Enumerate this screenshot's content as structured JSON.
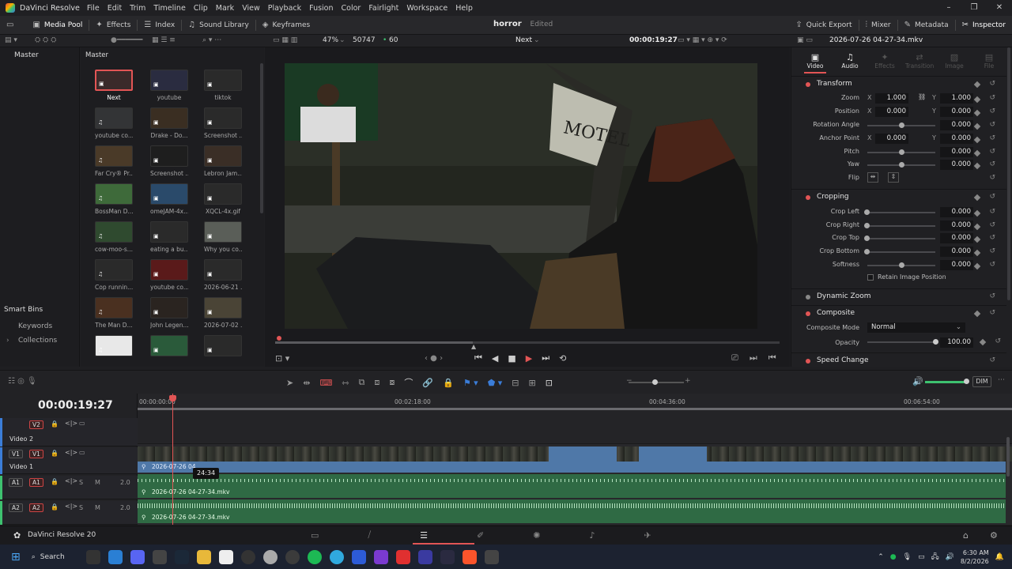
{
  "app": {
    "title": "DaVinci Resolve",
    "menu": [
      "File",
      "Edit",
      "Trim",
      "Timeline",
      "Clip",
      "Mark",
      "View",
      "Playback",
      "Fusion",
      "Color",
      "Fairlight",
      "Workspace",
      "Help"
    ]
  },
  "toolbar": {
    "media_pool": "Media Pool",
    "effects": "Effects",
    "index": "Index",
    "sound_library": "Sound Library",
    "keyframes": "Keyframes",
    "project_name": "horror",
    "project_status": "Edited",
    "quick_export": "Quick Export",
    "mixer": "Mixer",
    "metadata": "Metadata",
    "inspector": "Inspector"
  },
  "subbar": {
    "zoom": "47%",
    "frame_count": "50747",
    "fps": "60",
    "timeline_name": "Next",
    "timecode": "00:00:19:27",
    "clip_name": "2026-07-26 04-27-34.mkv"
  },
  "bins": {
    "master": "Master",
    "pool_title": "Master",
    "smart_bins": "Smart Bins",
    "keywords": "Keywords",
    "collections": "Collections"
  },
  "media_items": [
    {
      "label": "Next",
      "selected": true,
      "color": "#3a2a2a"
    },
    {
      "label": "youtube",
      "color": "#2a2c40"
    },
    {
      "label": "tiktok",
      "color": "#2a2a2a"
    },
    {
      "label": "youtube co...",
      "color": "#333436"
    },
    {
      "label": "Drake - Do...",
      "color": "#3a2e22"
    },
    {
      "label": "Screenshot ...",
      "color": "#2a2a2a"
    },
    {
      "label": "Far Cry® Pr...",
      "color": "#4a3a28"
    },
    {
      "label": "Screenshot ...",
      "color": "#1e1e1e"
    },
    {
      "label": "Lebron Jam...",
      "color": "#3a2e26"
    },
    {
      "label": "BossMan D...",
      "color": "#3e6a3a"
    },
    {
      "label": "omeJAM-4x...",
      "color": "#2a4a6a"
    },
    {
      "label": "XQCL-4x.gif",
      "color": "#2a2a2a"
    },
    {
      "label": "cow-moo-s...",
      "color": "#2f4a2f"
    },
    {
      "label": "eating a bu...",
      "color": "#2a2a2a"
    },
    {
      "label": "Why you co...",
      "color": "#5a5e58"
    },
    {
      "label": "Cop runnin...",
      "color": "#2a2a2a"
    },
    {
      "label": "youtube co...",
      "color": "#5a1a1a"
    },
    {
      "label": "2026-06-21 ...",
      "color": "#2a2a2a"
    },
    {
      "label": "The Man D...",
      "color": "#4a3020"
    },
    {
      "label": "John Legen...",
      "color": "#2a2420"
    },
    {
      "label": "2026-07-02 ...",
      "color": "#4a4436"
    },
    {
      "label": "",
      "color": "#e8e8e8"
    },
    {
      "label": "",
      "color": "#2a5a3a"
    },
    {
      "label": "",
      "color": "#2a2a2a"
    }
  ],
  "viewer": {
    "sign_text": "MOTEL",
    "transport_label": "Next"
  },
  "inspector": {
    "tabs": [
      "Video",
      "Audio",
      "Effects",
      "Transition",
      "Image",
      "File"
    ],
    "transform_title": "Transform",
    "zoom_label": "Zoom",
    "zoom_x": "1.000",
    "zoom_y": "1.000",
    "position_label": "Position",
    "position_x": "0.000",
    "position_y": "0.000",
    "rotation_label": "Rotation Angle",
    "rotation_val": "0.000",
    "anchor_label": "Anchor Point",
    "anchor_x": "0.000",
    "anchor_y": "0.000",
    "pitch_label": "Pitch",
    "pitch_val": "0.000",
    "yaw_label": "Yaw",
    "yaw_val": "0.000",
    "flip_label": "Flip",
    "cropping_title": "Cropping",
    "crop_left_label": "Crop Left",
    "crop_left": "0.000",
    "crop_right_label": "Crop Right",
    "crop_right": "0.000",
    "crop_top_label": "Crop Top",
    "crop_top": "0.000",
    "crop_bottom_label": "Crop Bottom",
    "crop_bottom": "0.000",
    "softness_label": "Softness",
    "softness": "0.000",
    "retain_label": "Retain Image Position",
    "dynamic_zoom_title": "Dynamic Zoom",
    "composite_title": "Composite",
    "composite_mode_label": "Composite Mode",
    "composite_mode": "Normal",
    "opacity_label": "Opacity",
    "opacity": "100.00",
    "speed_change_title": "Speed Change",
    "x": "X",
    "y": "Y"
  },
  "timeline": {
    "timecode": "00:00:19:27",
    "ruler": [
      "00:00:00:00",
      "00:02:18:00",
      "00:04:36:00",
      "00:06:54:00"
    ],
    "dim": "DIM",
    "tooltip": "24:34",
    "tracks": [
      {
        "id": "V2",
        "name": "Video 2"
      },
      {
        "id": "V1",
        "name": "Video 1"
      },
      {
        "id": "A1",
        "name": "",
        "level": "2.0"
      },
      {
        "id": "A2",
        "name": "",
        "level": "2.0"
      }
    ],
    "clip_video": "2026-07-26 04",
    "clip_a1": "2026-07-26 04-27-34.mkv",
    "clip_a2": "2026-07-26 04-27-34.mkv",
    "solo": "S",
    "mute": "M"
  },
  "pagebar": {
    "app_label": "DaVinci Resolve 20"
  },
  "taskbar": {
    "search": "Search",
    "time": "6:30 AM",
    "date": "8/2/2026"
  }
}
